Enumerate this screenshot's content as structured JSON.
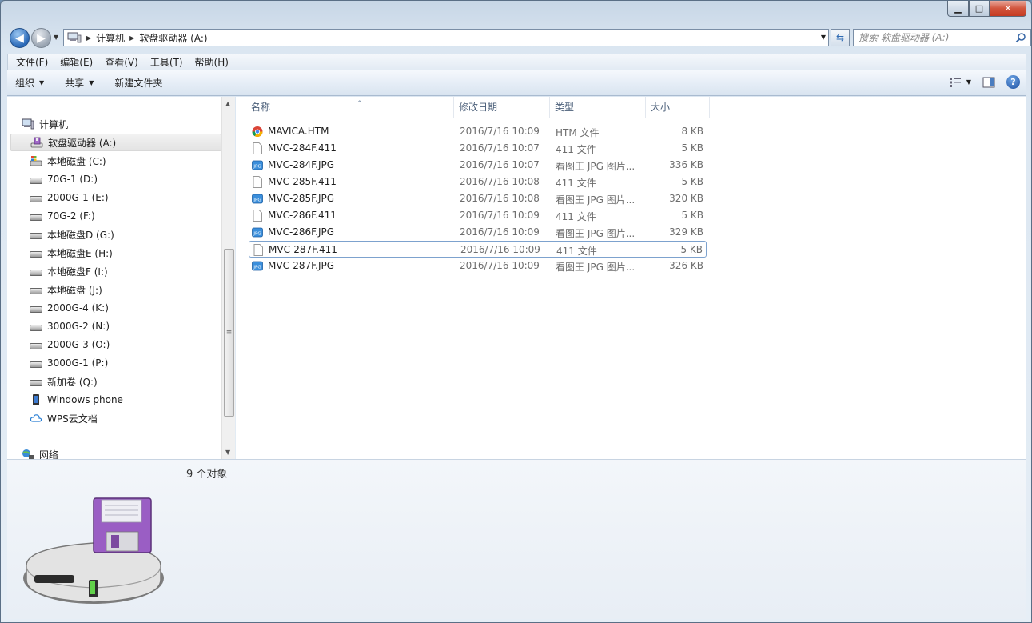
{
  "window": {
    "caption": {
      "minimize": "▁",
      "maximize": "□",
      "close": "✕"
    },
    "colors": {
      "accent": "#2a69b8",
      "close": "#c53b22"
    }
  },
  "address": {
    "segments": [
      "计算机",
      "软盘驱动器 (A:)"
    ],
    "icon": "computer-icon"
  },
  "search": {
    "placeholder": "搜索 软盘驱动器 (A:)"
  },
  "menubar": {
    "items": [
      "文件(F)",
      "编辑(E)",
      "查看(V)",
      "工具(T)",
      "帮助(H)"
    ]
  },
  "toolbar": {
    "organize": "组织",
    "share": "共享",
    "new_folder": "新建文件夹",
    "help_glyph": "?"
  },
  "navpane": {
    "computer": "计算机",
    "drives": [
      {
        "label": "软盘驱动器 (A:)",
        "icon": "floppy-drive-icon",
        "selected": true
      },
      {
        "label": "本地磁盘 (C:)",
        "icon": "system-drive-icon"
      },
      {
        "label": "70G-1 (D:)",
        "icon": "drive-icon"
      },
      {
        "label": "2000G-1 (E:)",
        "icon": "drive-icon"
      },
      {
        "label": "70G-2 (F:)",
        "icon": "drive-icon"
      },
      {
        "label": "本地磁盘D (G:)",
        "icon": "drive-icon"
      },
      {
        "label": "本地磁盘E (H:)",
        "icon": "drive-icon"
      },
      {
        "label": "本地磁盘F (I:)",
        "icon": "drive-icon"
      },
      {
        "label": "本地磁盘 (J:)",
        "icon": "drive-icon"
      },
      {
        "label": "2000G-4 (K:)",
        "icon": "drive-icon"
      },
      {
        "label": "3000G-2 (N:)",
        "icon": "drive-icon"
      },
      {
        "label": "2000G-3 (O:)",
        "icon": "drive-icon"
      },
      {
        "label": "3000G-1 (P:)",
        "icon": "drive-icon"
      },
      {
        "label": "新加卷 (Q:)",
        "icon": "drive-icon"
      },
      {
        "label": "Windows phone",
        "icon": "phone-icon"
      },
      {
        "label": "WPS云文档",
        "icon": "cloud-icon"
      }
    ],
    "network": "网络"
  },
  "columns": {
    "name": "名称",
    "date": "修改日期",
    "type": "类型",
    "size": "大小"
  },
  "files": [
    {
      "name": "MAVICA.HTM",
      "date": "2016/7/16 10:09",
      "type": "HTM 文件",
      "size": "8 KB",
      "icon": "chrome-icon"
    },
    {
      "name": "MVC-284F.411",
      "date": "2016/7/16 10:07",
      "type": "411 文件",
      "size": "5 KB",
      "icon": "blank-file-icon"
    },
    {
      "name": "MVC-284F.JPG",
      "date": "2016/7/16 10:07",
      "type": "看图王 JPG 图片...",
      "size": "336 KB",
      "icon": "jpg-icon"
    },
    {
      "name": "MVC-285F.411",
      "date": "2016/7/16 10:08",
      "type": "411 文件",
      "size": "5 KB",
      "icon": "blank-file-icon"
    },
    {
      "name": "MVC-285F.JPG",
      "date": "2016/7/16 10:08",
      "type": "看图王 JPG 图片...",
      "size": "320 KB",
      "icon": "jpg-icon"
    },
    {
      "name": "MVC-286F.411",
      "date": "2016/7/16 10:09",
      "type": "411 文件",
      "size": "5 KB",
      "icon": "blank-file-icon"
    },
    {
      "name": "MVC-286F.JPG",
      "date": "2016/7/16 10:09",
      "type": "看图王 JPG 图片...",
      "size": "329 KB",
      "icon": "jpg-icon"
    },
    {
      "name": "MVC-287F.411",
      "date": "2016/7/16 10:09",
      "type": "411 文件",
      "size": "5 KB",
      "icon": "blank-file-icon",
      "focused": true
    },
    {
      "name": "MVC-287F.JPG",
      "date": "2016/7/16 10:09",
      "type": "看图王 JPG 图片...",
      "size": "326 KB",
      "icon": "jpg-icon"
    }
  ],
  "details": {
    "count": "9 个对象",
    "icon": "floppy-drive-large-icon"
  }
}
